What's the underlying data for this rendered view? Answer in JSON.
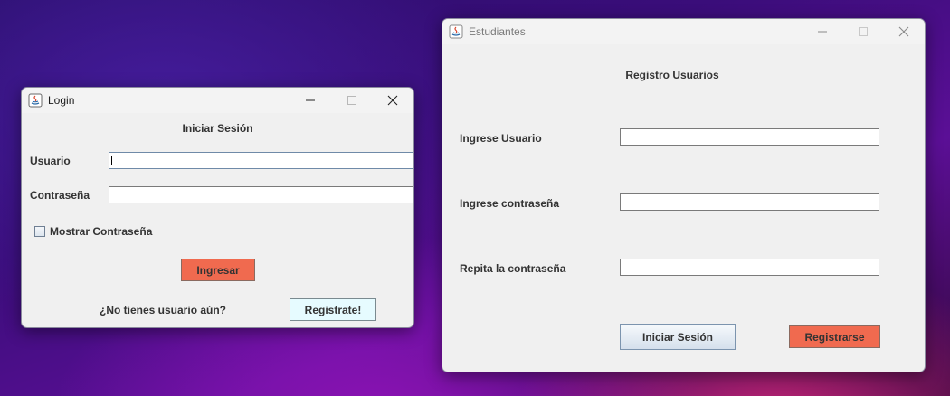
{
  "login": {
    "title": "Login",
    "heading": "Iniciar Sesión",
    "usuario_label": "Usuario",
    "usuario_value": "",
    "contrasena_label": "Contraseña",
    "contrasena_value": "",
    "mostrar_label": "Mostrar Contraseña",
    "mostrar_checked": false,
    "ingresar_label": "Ingresar",
    "no_usuario_text": "¿No tienes usuario aún?",
    "registrate_label": "Registrate!"
  },
  "estudiantes": {
    "title": "Estudiantes",
    "heading": "Registro Usuarios",
    "usuario_label": "Ingrese Usuario",
    "usuario_value": "",
    "contrasena_label": "Ingrese contraseña",
    "contrasena_value": "",
    "repita_label": "Repita la contraseña",
    "repita_value": "",
    "iniciar_label": "Iniciar Sesión",
    "registrarse_label": "Registrarse"
  },
  "colors": {
    "orange_button": "#f06a4f",
    "cyan_button": "#e6fbff",
    "window_bg": "#f0f0f0"
  },
  "icons": [
    "java-icon",
    "minimize-icon",
    "maximize-icon",
    "close-icon"
  ]
}
